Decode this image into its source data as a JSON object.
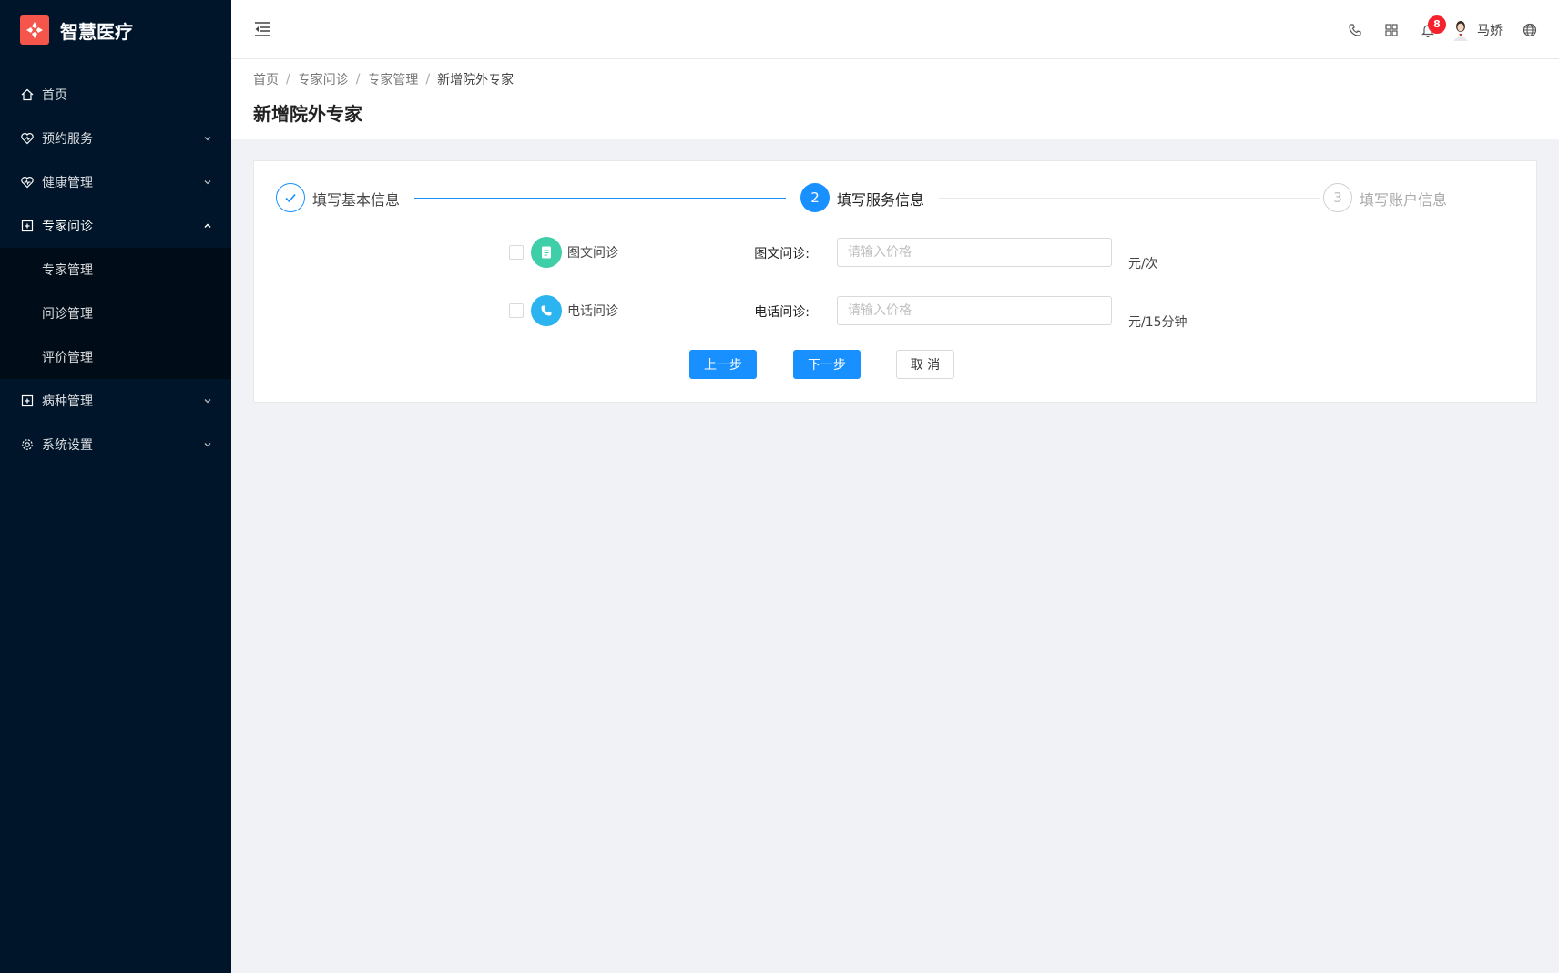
{
  "app": {
    "name": "智慧医疗",
    "brand_color": "#f5554a",
    "sidebar_bg": "#001529"
  },
  "sidebar": {
    "items": [
      {
        "label": "首页",
        "icon": "home-icon"
      },
      {
        "label": "预约服务",
        "icon": "heart-shield-icon"
      },
      {
        "label": "健康管理",
        "icon": "heart-pulse-icon"
      },
      {
        "label": "专家问诊",
        "icon": "medical-box-icon",
        "expanded": true
      },
      {
        "label": "病种管理",
        "icon": "medical-box-icon"
      },
      {
        "label": "系统设置",
        "icon": "gear-icon"
      }
    ],
    "sub_items": [
      {
        "label": "专家管理"
      },
      {
        "label": "问诊管理"
      },
      {
        "label": "评价管理"
      }
    ]
  },
  "header": {
    "notification_count": "8",
    "user_name": "马娇"
  },
  "breadcrumb": {
    "items": [
      "首页",
      "专家问诊",
      "专家管理",
      "新增院外专家"
    ]
  },
  "page": {
    "title": "新增院外专家"
  },
  "steps": [
    {
      "label": "填写基本信息",
      "status": "finished"
    },
    {
      "number": "2",
      "label": "填写服务信息",
      "status": "active"
    },
    {
      "number": "3",
      "label": "填写账户信息",
      "status": "waiting"
    }
  ],
  "services": [
    {
      "name": "图文问诊",
      "field_label": "图文问诊:",
      "placeholder": "请输入价格",
      "value": "",
      "unit": "元/次",
      "checked": false,
      "icon_color": "#3ecfa8"
    },
    {
      "name": "电话问诊",
      "field_label": "电话问诊:",
      "placeholder": "请输入价格",
      "value": "",
      "unit": "元/15分钟",
      "checked": false,
      "icon_color": "#2bb4f0"
    }
  ],
  "buttons": {
    "prev": "上一步",
    "next": "下一步",
    "cancel": "取 消"
  },
  "colors": {
    "primary": "#1890ff"
  }
}
